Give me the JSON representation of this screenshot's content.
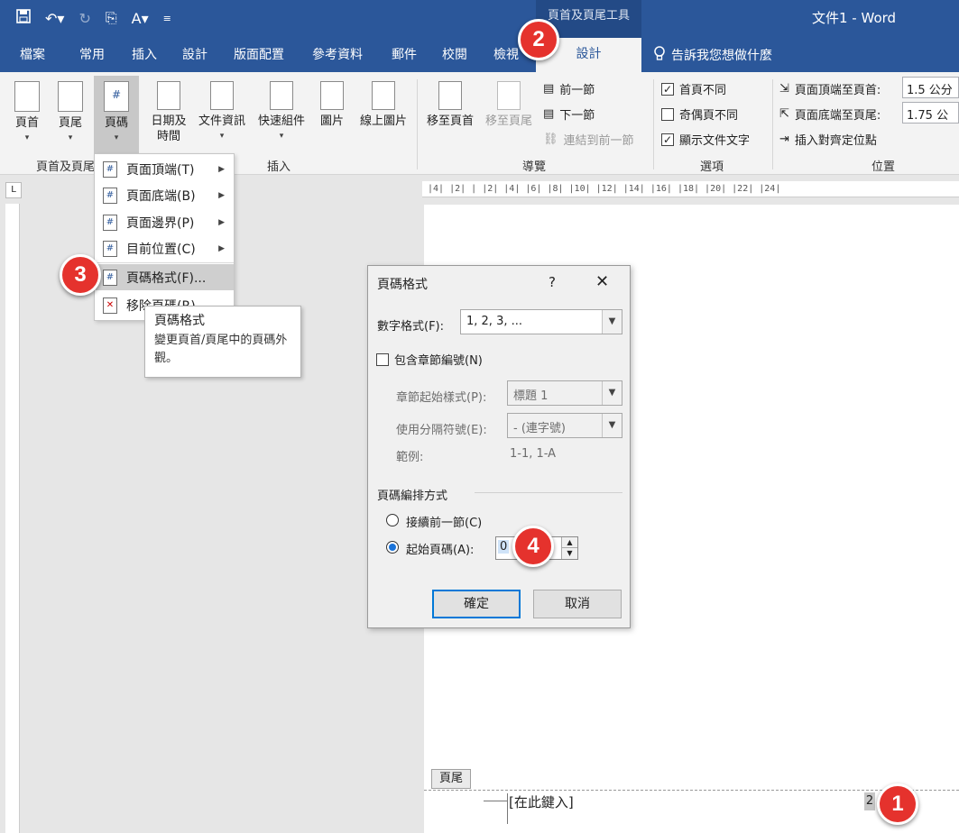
{
  "titlebar": {
    "context_title": "頁首及頁尾工具",
    "doc_title": "文件1  -  Word"
  },
  "tabs": [
    "檔案",
    "常用",
    "插入",
    "設計",
    "版面配置",
    "參考資料",
    "郵件",
    "校閱",
    "檢視"
  ],
  "context_tab": "設計",
  "tellme": "告訴我您想做什麼",
  "ribbon": {
    "header": "頁首",
    "footer": "頁尾",
    "pagenum": "頁碼",
    "date1": "日期及",
    "date2": "時間",
    "docinfo": "文件資訊",
    "quickparts": "快速組件",
    "picture": "圖片",
    "online_pic": "線上圖片",
    "goto_header": "移至頁首",
    "goto_footer": "移至頁尾",
    "prev": "前一節",
    "next": "下一節",
    "link": "連結到前一節",
    "opt_first": "首頁不同",
    "opt_oddeven": "奇偶頁不同",
    "opt_show": "顯示文件文字",
    "pos_top_label": "頁面頂端至頁首:",
    "pos_top_val": "1.5 公分",
    "pos_bottom_label": "頁面底端至頁尾:",
    "pos_bottom_val": "1.75 公分",
    "pos_align": "插入對齊定位點",
    "grp_hf": "頁首及頁尾",
    "grp_insert": "插入",
    "grp_nav": "導覽",
    "grp_opt": "選項",
    "grp_pos": "位置"
  },
  "menu": {
    "items": [
      "頁面頂端(T)",
      "頁面底端(B)",
      "頁面邊界(P)",
      "目前位置(C)",
      "頁碼格式(F)...",
      "移除頁碼(R)"
    ]
  },
  "tooltip": {
    "title": "頁碼格式",
    "body": "變更頁首/頁尾中的頁碼外觀。"
  },
  "dialog": {
    "title": "頁碼格式",
    "help": "?",
    "number_format_label": "數字格式(F):",
    "number_format_value": "1, 2, 3, ...",
    "include_chapter": "包含章節編號(N)",
    "chapter_style_label": "章節起始樣式(P):",
    "chapter_style_value": "標題 1",
    "separator_label": "使用分隔符號(E):",
    "separator_value": "-   (連字號)",
    "example_label": "範例:",
    "example_value": "1-1, 1-A",
    "numbering_label": "頁碼編排方式",
    "continue": "接續前一節(C)",
    "start_at": "起始頁碼(A):",
    "start_value": "0",
    "ok": "確定",
    "cancel": "取消"
  },
  "ruler": {
    "h": "|4| |2| |  |2| |4| |6| |8| |10| |12| |14| |16| |18| |20| |22| |24|",
    "corner": "L"
  },
  "document": {
    "footer_tag": "頁尾",
    "footer_text": "[在此鍵入]",
    "page_number": "2"
  },
  "badges": [
    "1",
    "2",
    "3",
    "4"
  ],
  "colors": {
    "accent": "#2b579a",
    "badge": "#e5322d"
  }
}
